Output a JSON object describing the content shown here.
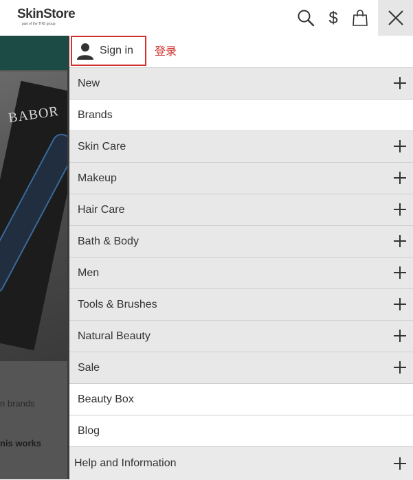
{
  "header": {
    "logo_name": "SkinStore",
    "logo_sub": "part of the THG group",
    "icons": [
      "search-icon",
      "currency-icon",
      "bag-icon",
      "close-icon"
    ]
  },
  "background_page": {
    "brand_text": "BABOR",
    "text_1": "n brands",
    "text_2": "nis works"
  },
  "menu": {
    "signin_label": "Sign in",
    "signin_annotation": "登录",
    "items": [
      {
        "label": "New",
        "expandable": true
      },
      {
        "label": "Brands",
        "expandable": false
      },
      {
        "label": "Skin Care",
        "expandable": true
      },
      {
        "label": "Makeup",
        "expandable": true
      },
      {
        "label": "Hair Care",
        "expandable": true
      },
      {
        "label": "Bath & Body",
        "expandable": true
      },
      {
        "label": "Men",
        "expandable": true
      },
      {
        "label": "Tools & Brushes",
        "expandable": true
      },
      {
        "label": "Natural Beauty",
        "expandable": true
      },
      {
        "label": "Sale",
        "expandable": true
      },
      {
        "label": "Beauty Box",
        "expandable": false
      },
      {
        "label": "Blog",
        "expandable": false
      }
    ],
    "help_label": "Help and Information"
  },
  "colors": {
    "highlight": "#d0312d",
    "teal": "#1c4a44",
    "menu_grey": "#e8e8e8"
  }
}
